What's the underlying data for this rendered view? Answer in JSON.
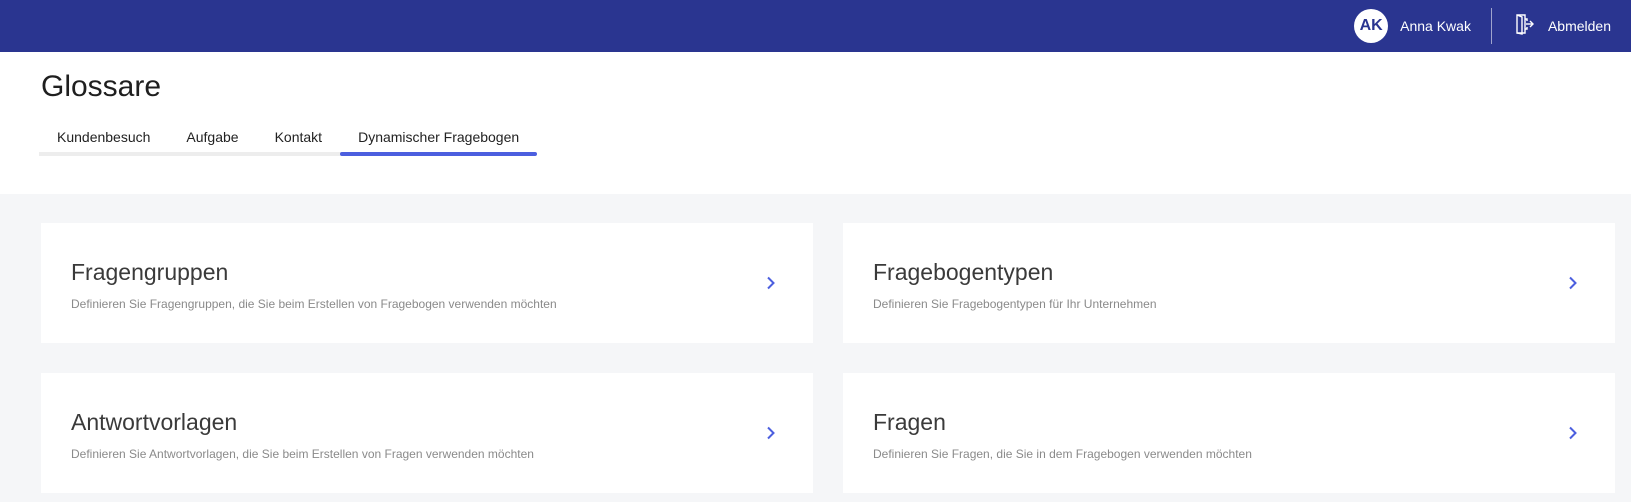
{
  "topbar": {
    "avatar_initials": "AK",
    "user_name": "Anna Kwak",
    "logout_label": "Abmelden",
    "background_color": "#2a3590"
  },
  "page": {
    "title": "Glossare"
  },
  "tabs": [
    {
      "label": "Kundenbesuch",
      "active": false
    },
    {
      "label": "Aufgabe",
      "active": false
    },
    {
      "label": "Kontakt",
      "active": false
    },
    {
      "label": "Dynamischer Fragebogen",
      "active": true
    }
  ],
  "cards": [
    {
      "title": "Fragengruppen",
      "description": "Definieren Sie Fragengruppen, die Sie beim Erstellen von Fragebogen verwenden möchten",
      "icon": "chevron-right-icon"
    },
    {
      "title": "Fragebogentypen",
      "description": "Definieren Sie Fragebogentypen für Ihr Unternehmen",
      "icon": "chevron-right-icon"
    },
    {
      "title": "Antwortvorlagen",
      "description": "Definieren Sie Antwortvorlagen, die Sie beim Erstellen von Fragen verwenden möchten",
      "icon": "chevron-right-icon"
    },
    {
      "title": "Fragen",
      "description": "Definieren Sie Fragen, die Sie in dem Fragebogen verwenden möchten",
      "icon": "chevron-right-icon"
    }
  ],
  "colors": {
    "accent": "#4c5fdf",
    "content_background": "#f5f6f8"
  }
}
